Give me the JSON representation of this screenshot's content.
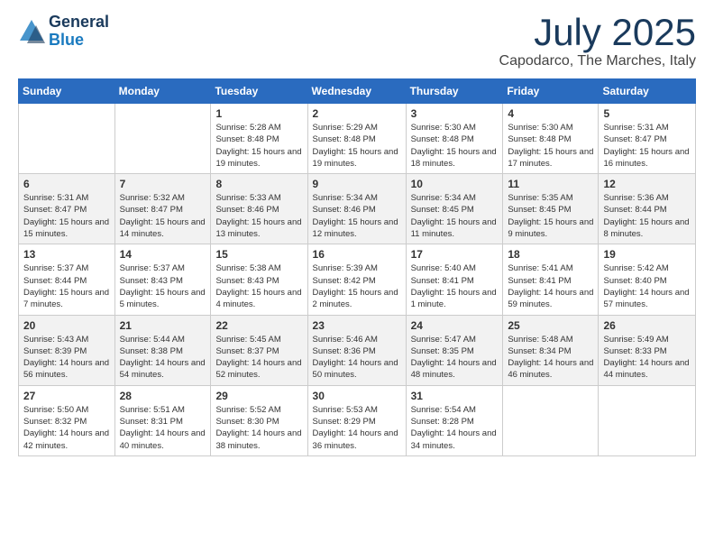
{
  "header": {
    "logo": {
      "general": "General",
      "blue": "Blue"
    },
    "title": "July 2025",
    "location": "Capodarco, The Marches, Italy"
  },
  "calendar": {
    "days_of_week": [
      "Sunday",
      "Monday",
      "Tuesday",
      "Wednesday",
      "Thursday",
      "Friday",
      "Saturday"
    ],
    "weeks": [
      [
        {
          "day": "",
          "empty": true
        },
        {
          "day": "",
          "empty": true
        },
        {
          "day": "1",
          "sunrise": "5:28 AM",
          "sunset": "8:48 PM",
          "daylight": "15 hours and 19 minutes."
        },
        {
          "day": "2",
          "sunrise": "5:29 AM",
          "sunset": "8:48 PM",
          "daylight": "15 hours and 19 minutes."
        },
        {
          "day": "3",
          "sunrise": "5:30 AM",
          "sunset": "8:48 PM",
          "daylight": "15 hours and 18 minutes."
        },
        {
          "day": "4",
          "sunrise": "5:30 AM",
          "sunset": "8:48 PM",
          "daylight": "15 hours and 17 minutes."
        },
        {
          "day": "5",
          "sunrise": "5:31 AM",
          "sunset": "8:47 PM",
          "daylight": "15 hours and 16 minutes."
        }
      ],
      [
        {
          "day": "6",
          "sunrise": "5:31 AM",
          "sunset": "8:47 PM",
          "daylight": "15 hours and 15 minutes."
        },
        {
          "day": "7",
          "sunrise": "5:32 AM",
          "sunset": "8:47 PM",
          "daylight": "15 hours and 14 minutes."
        },
        {
          "day": "8",
          "sunrise": "5:33 AM",
          "sunset": "8:46 PM",
          "daylight": "15 hours and 13 minutes."
        },
        {
          "day": "9",
          "sunrise": "5:34 AM",
          "sunset": "8:46 PM",
          "daylight": "15 hours and 12 minutes."
        },
        {
          "day": "10",
          "sunrise": "5:34 AM",
          "sunset": "8:45 PM",
          "daylight": "15 hours and 11 minutes."
        },
        {
          "day": "11",
          "sunrise": "5:35 AM",
          "sunset": "8:45 PM",
          "daylight": "15 hours and 9 minutes."
        },
        {
          "day": "12",
          "sunrise": "5:36 AM",
          "sunset": "8:44 PM",
          "daylight": "15 hours and 8 minutes."
        }
      ],
      [
        {
          "day": "13",
          "sunrise": "5:37 AM",
          "sunset": "8:44 PM",
          "daylight": "15 hours and 7 minutes."
        },
        {
          "day": "14",
          "sunrise": "5:37 AM",
          "sunset": "8:43 PM",
          "daylight": "15 hours and 5 minutes."
        },
        {
          "day": "15",
          "sunrise": "5:38 AM",
          "sunset": "8:43 PM",
          "daylight": "15 hours and 4 minutes."
        },
        {
          "day": "16",
          "sunrise": "5:39 AM",
          "sunset": "8:42 PM",
          "daylight": "15 hours and 2 minutes."
        },
        {
          "day": "17",
          "sunrise": "5:40 AM",
          "sunset": "8:41 PM",
          "daylight": "15 hours and 1 minute."
        },
        {
          "day": "18",
          "sunrise": "5:41 AM",
          "sunset": "8:41 PM",
          "daylight": "14 hours and 59 minutes."
        },
        {
          "day": "19",
          "sunrise": "5:42 AM",
          "sunset": "8:40 PM",
          "daylight": "14 hours and 57 minutes."
        }
      ],
      [
        {
          "day": "20",
          "sunrise": "5:43 AM",
          "sunset": "8:39 PM",
          "daylight": "14 hours and 56 minutes."
        },
        {
          "day": "21",
          "sunrise": "5:44 AM",
          "sunset": "8:38 PM",
          "daylight": "14 hours and 54 minutes."
        },
        {
          "day": "22",
          "sunrise": "5:45 AM",
          "sunset": "8:37 PM",
          "daylight": "14 hours and 52 minutes."
        },
        {
          "day": "23",
          "sunrise": "5:46 AM",
          "sunset": "8:36 PM",
          "daylight": "14 hours and 50 minutes."
        },
        {
          "day": "24",
          "sunrise": "5:47 AM",
          "sunset": "8:35 PM",
          "daylight": "14 hours and 48 minutes."
        },
        {
          "day": "25",
          "sunrise": "5:48 AM",
          "sunset": "8:34 PM",
          "daylight": "14 hours and 46 minutes."
        },
        {
          "day": "26",
          "sunrise": "5:49 AM",
          "sunset": "8:33 PM",
          "daylight": "14 hours and 44 minutes."
        }
      ],
      [
        {
          "day": "27",
          "sunrise": "5:50 AM",
          "sunset": "8:32 PM",
          "daylight": "14 hours and 42 minutes."
        },
        {
          "day": "28",
          "sunrise": "5:51 AM",
          "sunset": "8:31 PM",
          "daylight": "14 hours and 40 minutes."
        },
        {
          "day": "29",
          "sunrise": "5:52 AM",
          "sunset": "8:30 PM",
          "daylight": "14 hours and 38 minutes."
        },
        {
          "day": "30",
          "sunrise": "5:53 AM",
          "sunset": "8:29 PM",
          "daylight": "14 hours and 36 minutes."
        },
        {
          "day": "31",
          "sunrise": "5:54 AM",
          "sunset": "8:28 PM",
          "daylight": "14 hours and 34 minutes."
        },
        {
          "day": "",
          "empty": true
        },
        {
          "day": "",
          "empty": true
        }
      ]
    ]
  }
}
